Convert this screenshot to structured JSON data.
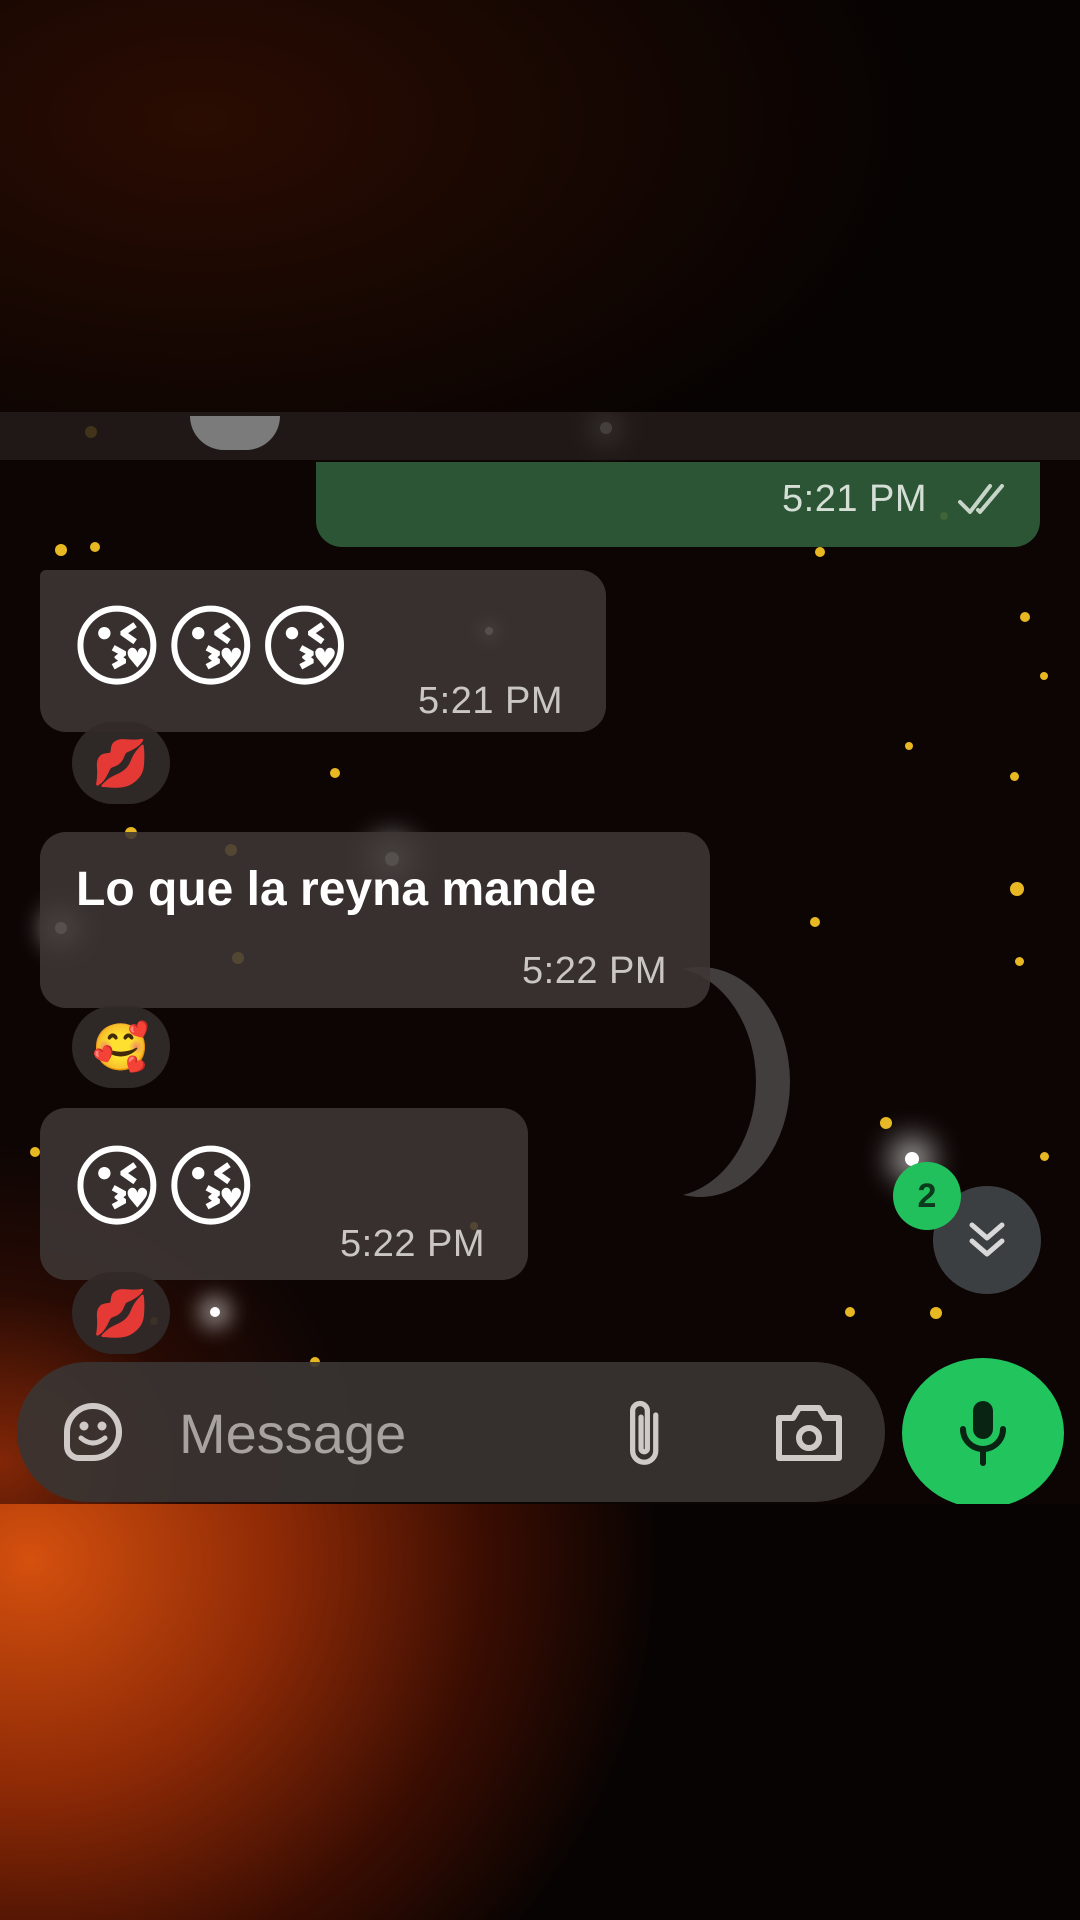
{
  "chat": {
    "outgoing_top": {
      "time": "5:21 PM",
      "status_icon": "double-check-icon"
    },
    "messages": [
      {
        "emojis": [
          "😘",
          "😘",
          "😘"
        ],
        "time": "5:21 PM",
        "reaction": "💋"
      },
      {
        "text": "Lo que la reyna mande",
        "time": "5:22 PM",
        "reaction": "🥰"
      },
      {
        "emojis": [
          "😘",
          "😘"
        ],
        "time": "5:22 PM",
        "reaction": "💋"
      }
    ],
    "unread_count": "2"
  },
  "composer": {
    "placeholder": "Message",
    "icons": [
      "sticker-icon",
      "attach-icon",
      "camera-icon",
      "mic-icon"
    ]
  },
  "colors": {
    "accent_green": "#21c45d",
    "bubble_in": "#3e3735",
    "bubble_out": "#2f5c3a"
  }
}
